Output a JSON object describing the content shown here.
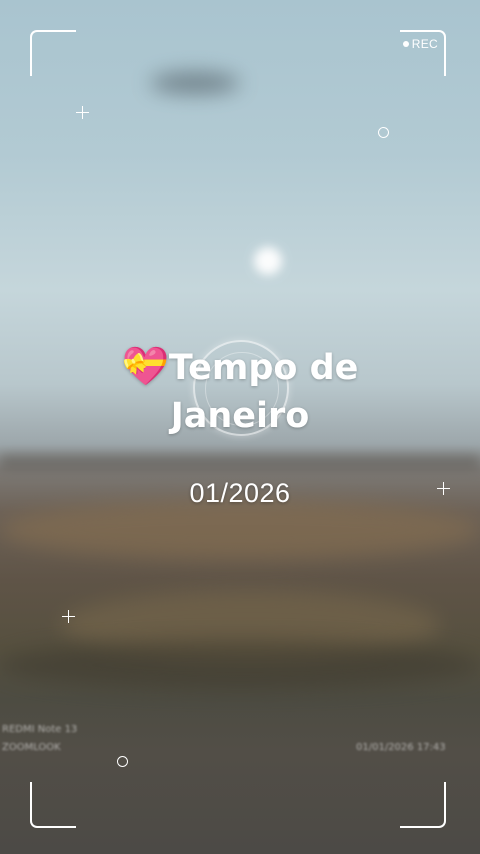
{
  "overlay": {
    "rec_label": "REC",
    "title_emoji": "💝",
    "title_line1": "Tempo de",
    "title_line2": "Janeiro",
    "date": "01/2026"
  },
  "background_watermark": {
    "line1": "REDMI Note 13",
    "line2": "ZOOMLOOK",
    "date_time": "01/01/2026 17:43"
  },
  "colors": {
    "overlay": "#ffffff",
    "sky": "#b2cad3",
    "ground": "#5f5447"
  },
  "icons": [
    "heart-ribbon-emoji",
    "rec-dot-icon",
    "crosshair-plus-icon",
    "ring-icon",
    "focus-circle-icon"
  ]
}
